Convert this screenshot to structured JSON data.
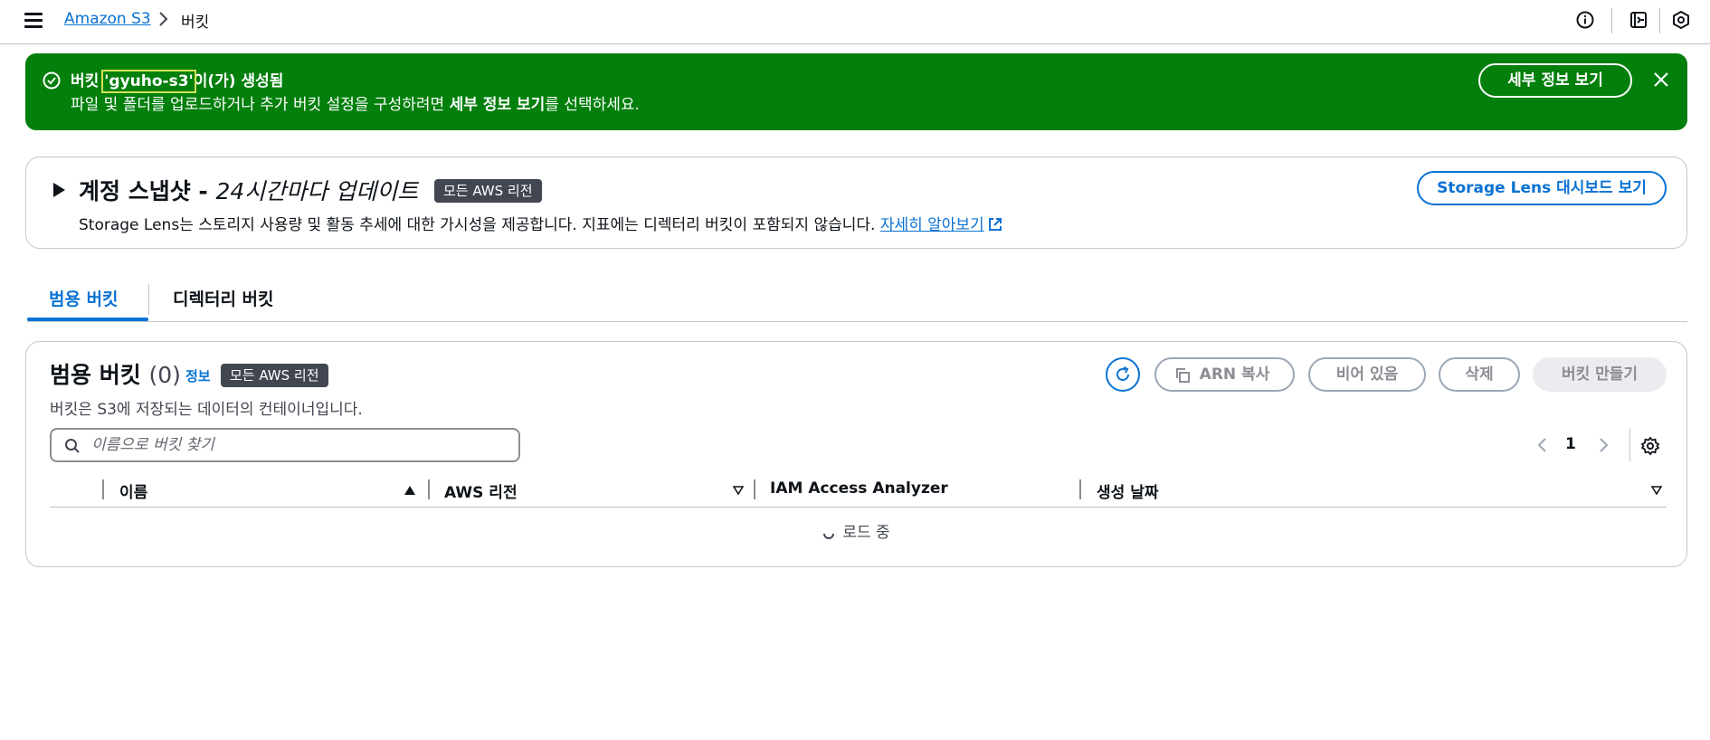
{
  "breadcrumb": {
    "root": "Amazon S3",
    "current": "버킷"
  },
  "flash": {
    "title_prefix": "버킷 ",
    "bucket_name": "'gyuho-s3'",
    "title_suffix": "이(가) 생성됨",
    "body_before": "파일 및 폴더를 업로드하거나 추가 버킷 설정을 구성하려면 ",
    "body_bold": "세부 정보 보기",
    "body_after": "를 선택하세요.",
    "button": "세부 정보 보기",
    "color": "#037f0c"
  },
  "storage_lens": {
    "title_bold": "계정 스냅샷 - ",
    "title_italic": "24시간마다 업데이트",
    "badge": "모든 AWS 리전",
    "desc_brand": "Storage Lens",
    "desc_text": "는 스토리지 사용량 및 활동 추세에 대한 가시성을 제공합니다. 지표에는 디렉터리 버킷이 포함되지 않습니다. ",
    "learn_more": "자세히 알아보기",
    "dashboard_button": "Storage Lens 대시보드 보기"
  },
  "tabs": [
    {
      "label": "범용 버킷",
      "active": true
    },
    {
      "label": "디렉터리 버킷",
      "active": false
    }
  ],
  "buckets_panel": {
    "title": "범용 버킷",
    "count": "(0)",
    "info": "정보",
    "badge": "모든 AWS 리전",
    "desc": "버킷은 S3에 저장되는 데이터의 컨테이너입니다.",
    "buttons": {
      "copy_arn": "ARN 복사",
      "empty": "비어 있음",
      "delete": "삭제",
      "create": "버킷 만들기"
    },
    "search_placeholder": "이름으로 버킷 찾기",
    "page": "1",
    "columns": [
      "이름",
      "AWS 리전",
      "IAM Access Analyzer",
      "생성 날짜"
    ],
    "loading": "로드 중"
  },
  "colors": {
    "accent": "#0972d3",
    "success": "#037f0c",
    "badge_bg": "#424650"
  }
}
